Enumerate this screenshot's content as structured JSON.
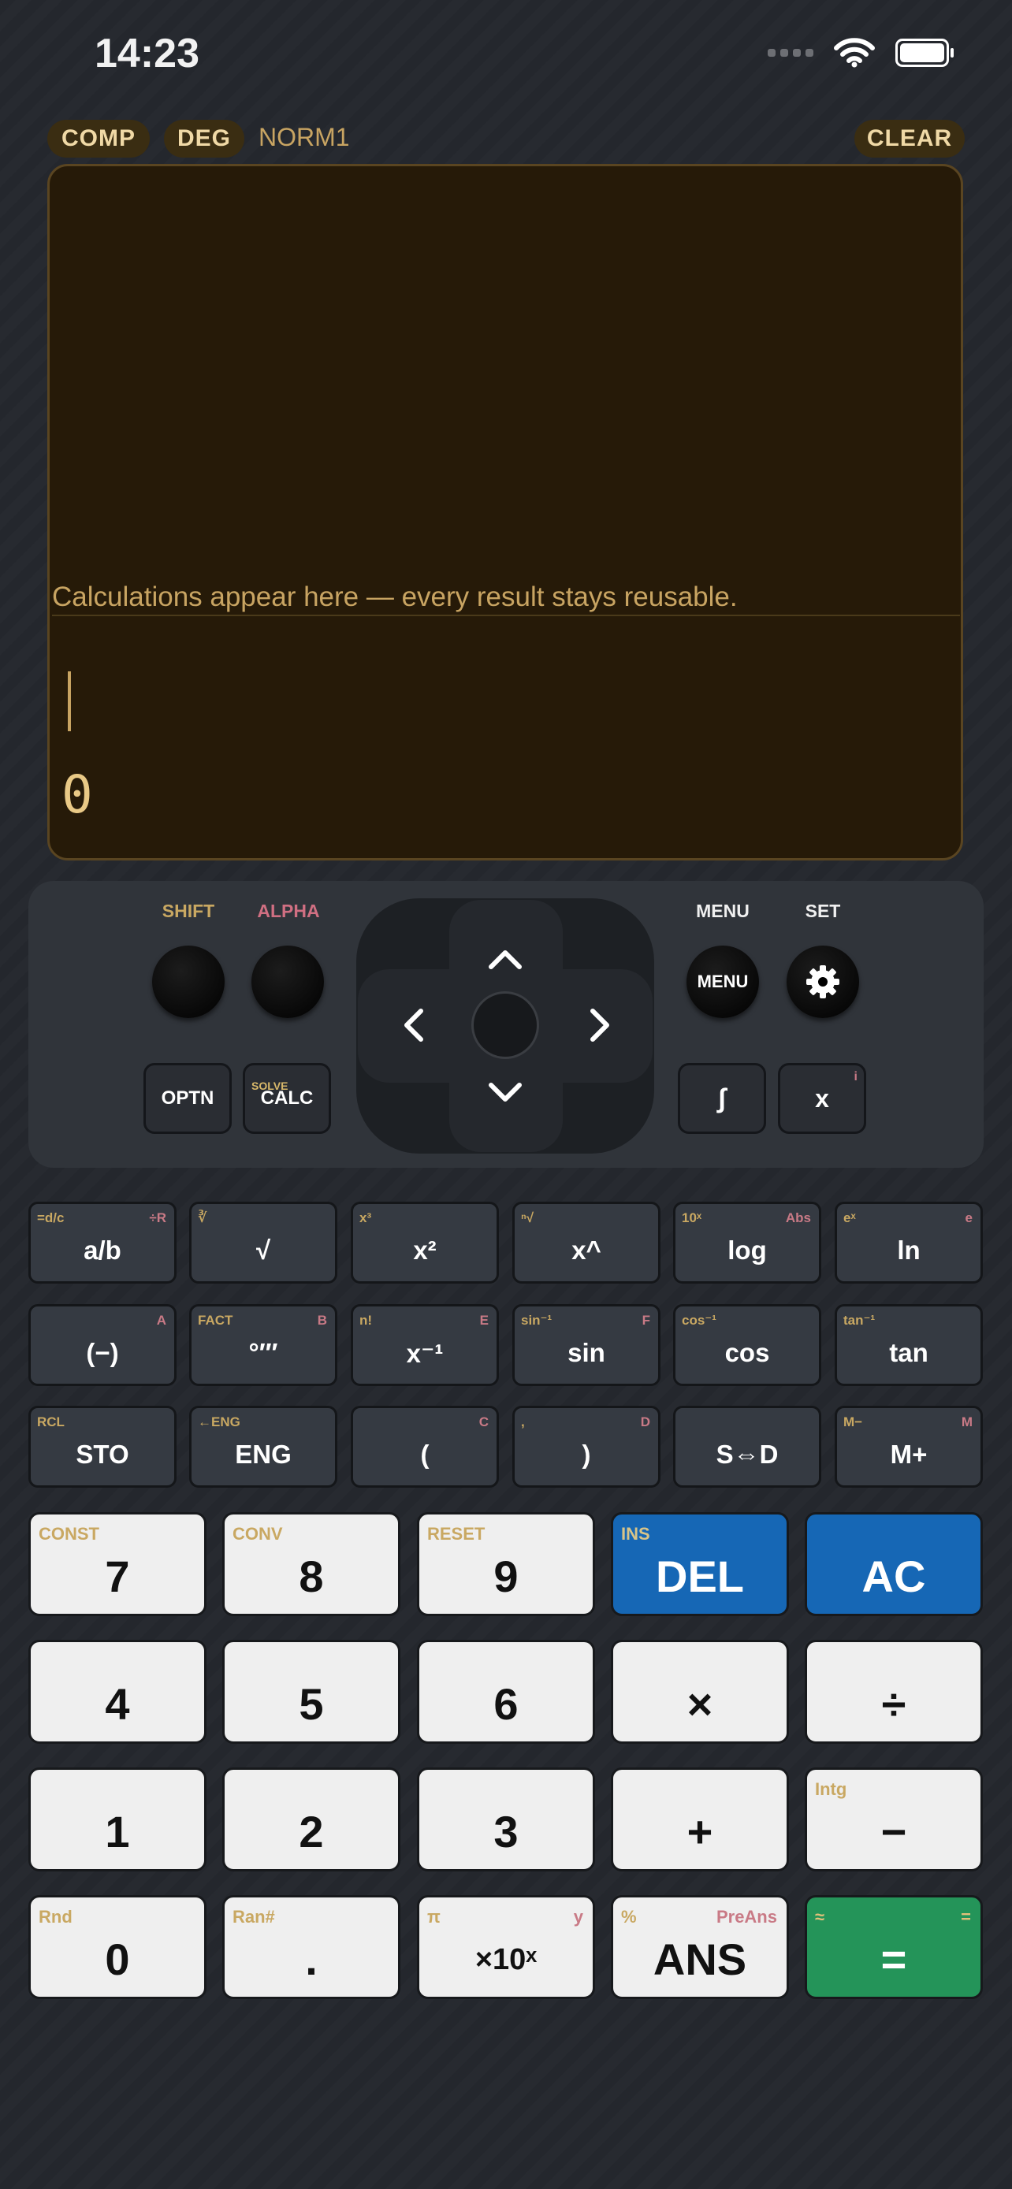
{
  "status": {
    "time": "14:23"
  },
  "header": {
    "mode1": "COMP",
    "mode2": "DEG",
    "norm": "NORM1",
    "clear": "CLEAR"
  },
  "display": {
    "hint": "Calculations appear here — every result stays reusable.",
    "result": "0"
  },
  "controls": {
    "shift": "SHIFT",
    "alpha": "ALPHA",
    "menu_label": "MENU",
    "set_label": "SET",
    "menu_button": "MENU",
    "optn": "OPTN",
    "calc": "CALC",
    "calc_sub": "SOLVE",
    "integral": "∫",
    "x": "x",
    "x_sub": "i"
  },
  "function_rows": [
    [
      {
        "main": "a/b",
        "shift": "=d/c",
        "alpha": "÷R"
      },
      {
        "main": "√",
        "shift": "∛",
        "alpha": ""
      },
      {
        "main": "x²",
        "shift": "x³",
        "alpha": ""
      },
      {
        "main": "x^",
        "shift": "ⁿ√",
        "alpha": ""
      },
      {
        "main": "log",
        "shift": "10ˣ",
        "alpha": "Abs"
      },
      {
        "main": "ln",
        "shift": "eˣ",
        "alpha": "e"
      }
    ],
    [
      {
        "main": "(−)",
        "shift": "",
        "alpha": "A"
      },
      {
        "main": "°′″",
        "shift": "FACT",
        "alpha": "B"
      },
      {
        "main": "x⁻¹",
        "shift": "n!",
        "alpha": "E"
      },
      {
        "main": "sin",
        "shift": "sin⁻¹",
        "alpha": "F"
      },
      {
        "main": "cos",
        "shift": "cos⁻¹",
        "alpha": ""
      },
      {
        "main": "tan",
        "shift": "tan⁻¹",
        "alpha": ""
      }
    ],
    [
      {
        "main": "STO",
        "shift": "RCL",
        "alpha": ""
      },
      {
        "main": "ENG",
        "shift": "←ENG",
        "alpha": ""
      },
      {
        "main": "(",
        "shift": "",
        "alpha": "C"
      },
      {
        "main": ")",
        "shift": ",",
        "alpha": "D"
      },
      {
        "main": "S⇔D",
        "shift": "",
        "alpha": ""
      },
      {
        "main": "M+",
        "shift": "M−",
        "alpha": "M"
      }
    ]
  ],
  "number_rows": [
    [
      {
        "main": "7",
        "shift": "CONST",
        "alpha": ""
      },
      {
        "main": "8",
        "shift": "CONV",
        "alpha": ""
      },
      {
        "main": "9",
        "shift": "RESET",
        "alpha": ""
      },
      {
        "main": "DEL",
        "shift": "INS",
        "alpha": ""
      },
      {
        "main": "AC",
        "shift": "",
        "alpha": ""
      }
    ],
    [
      {
        "main": "4",
        "shift": "",
        "alpha": ""
      },
      {
        "main": "5",
        "shift": "",
        "alpha": ""
      },
      {
        "main": "6",
        "shift": "",
        "alpha": ""
      },
      {
        "main": "×",
        "shift": "",
        "alpha": ""
      },
      {
        "main": "÷",
        "shift": "",
        "alpha": ""
      }
    ],
    [
      {
        "main": "1",
        "shift": "",
        "alpha": ""
      },
      {
        "main": "2",
        "shift": "",
        "alpha": ""
      },
      {
        "main": "3",
        "shift": "",
        "alpha": ""
      },
      {
        "main": "+",
        "shift": "",
        "alpha": ""
      },
      {
        "main": "−",
        "shift": "Intg",
        "alpha": ""
      }
    ],
    [
      {
        "main": "0",
        "shift": "Rnd",
        "alpha": ""
      },
      {
        "main": ".",
        "shift": "Ran#",
        "alpha": ""
      },
      {
        "main": "×10ˣ",
        "shift": "π",
        "alpha": "y"
      },
      {
        "main": "ANS",
        "shift": "%",
        "alpha": "PreAns"
      },
      {
        "main": "=",
        "shift": "≈",
        "alpha": "="
      }
    ]
  ],
  "colors": {
    "accent_blue": "#1667b5",
    "accent_green": "#249459",
    "display_bg": "#261a08",
    "display_text": "#c8a462"
  }
}
